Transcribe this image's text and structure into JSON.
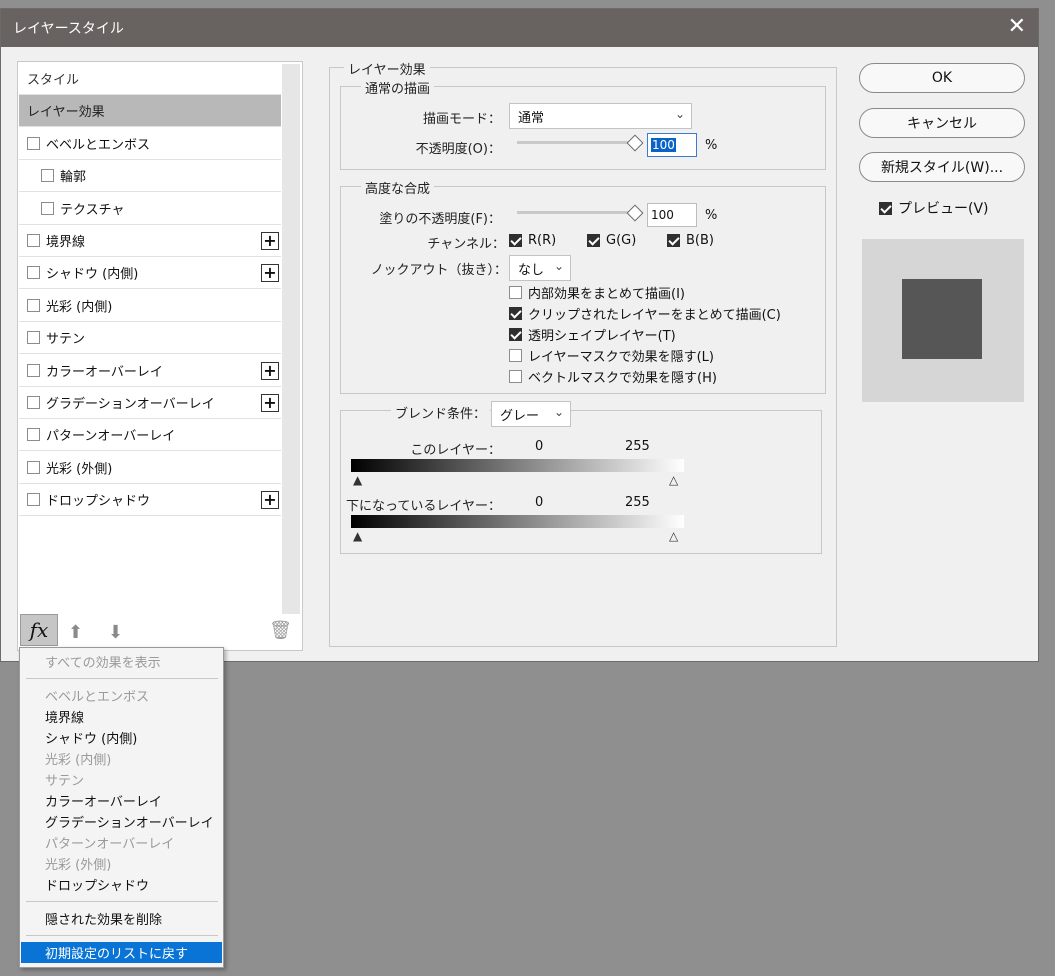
{
  "window": {
    "title": "レイヤースタイル",
    "close_icon": "close-icon"
  },
  "style_list": {
    "items": [
      {
        "label": "スタイル",
        "type": "heading"
      },
      {
        "label": "レイヤー効果",
        "type": "selected"
      },
      {
        "label": "ベベルとエンボス",
        "checked": false,
        "plus": false
      },
      {
        "label": "輪郭",
        "checked": false,
        "plus": false,
        "sub": true
      },
      {
        "label": "テクスチャ",
        "checked": false,
        "plus": false,
        "sub": true
      },
      {
        "label": "境界線",
        "checked": false,
        "plus": true
      },
      {
        "label": "シャドウ (内側)",
        "checked": false,
        "plus": true
      },
      {
        "label": "光彩 (内側)",
        "checked": false,
        "plus": false
      },
      {
        "label": "サテン",
        "checked": false,
        "plus": false
      },
      {
        "label": "カラーオーバーレイ",
        "checked": false,
        "plus": true
      },
      {
        "label": "グラデーションオーバーレイ",
        "checked": false,
        "plus": true
      },
      {
        "label": "パターンオーバーレイ",
        "checked": false,
        "plus": false
      },
      {
        "label": "光彩 (外側)",
        "checked": false,
        "plus": false
      },
      {
        "label": "ドロップシャドウ",
        "checked": false,
        "plus": true
      }
    ],
    "fx_label": "fx",
    "up_icon": "arrow-up-icon",
    "down_icon": "arrow-down-icon",
    "trash_icon": "trash-icon"
  },
  "layer_effects": {
    "legend": "レイヤー効果",
    "normal": {
      "legend": "通常の描画",
      "blend_label": "描画モード：",
      "blend_value": "通常",
      "opacity_label": "不透明度(O)：",
      "opacity_value": "100",
      "opacity_unit": "%"
    },
    "advanced": {
      "legend": "高度な合成",
      "fill_label": "塗りの不透明度(F)：",
      "fill_value": "100",
      "fill_unit": "%",
      "channel_label": "チャンネル：",
      "channels": [
        {
          "label": "R(R)",
          "checked": true
        },
        {
          "label": "G(G)",
          "checked": true
        },
        {
          "label": "B(B)",
          "checked": true
        }
      ],
      "knockout_label": "ノックアウト（抜き）：",
      "knockout_value": "なし",
      "options": [
        {
          "label": "内部効果をまとめて描画(I)",
          "checked": false
        },
        {
          "label": "クリップされたレイヤーをまとめて描画(C)",
          "checked": true
        },
        {
          "label": "透明シェイプレイヤー(T)",
          "checked": true
        },
        {
          "label": "レイヤーマスクで効果を隠す(L)",
          "checked": false
        },
        {
          "label": "ベクトルマスクで効果を隠す(H)",
          "checked": false
        }
      ]
    },
    "blend_if": {
      "label": "ブレンド条件：",
      "value": "グレー",
      "this_layer_label": "このレイヤー：",
      "this_min": "0",
      "this_max": "255",
      "under_layer_label": "下になっているレイヤー：",
      "under_min": "0",
      "under_max": "255"
    }
  },
  "buttons": {
    "ok": "OK",
    "cancel": "キャンセル",
    "new_style": "新規スタイル(W)...",
    "preview_label": "プレビュー(V)",
    "preview_checked": true
  },
  "fx_menu": {
    "items": [
      {
        "label": "すべての効果を表示",
        "enabled": false
      },
      {
        "sep": true
      },
      {
        "label": "ベベルとエンボス",
        "enabled": false
      },
      {
        "label": "境界線",
        "enabled": true
      },
      {
        "label": "シャドウ (内側)",
        "enabled": true
      },
      {
        "label": "光彩 (内側)",
        "enabled": false
      },
      {
        "label": "サテン",
        "enabled": false
      },
      {
        "label": "カラーオーバーレイ",
        "enabled": true
      },
      {
        "label": "グラデーションオーバーレイ",
        "enabled": true
      },
      {
        "label": "パターンオーバーレイ",
        "enabled": false
      },
      {
        "label": "光彩 (外側)",
        "enabled": false
      },
      {
        "label": "ドロップシャドウ",
        "enabled": true
      },
      {
        "sep": true
      },
      {
        "label": "隠された効果を削除",
        "enabled": true
      },
      {
        "sep": true
      },
      {
        "label": "初期設定のリストに戻す",
        "enabled": true,
        "highlight": true
      }
    ]
  }
}
